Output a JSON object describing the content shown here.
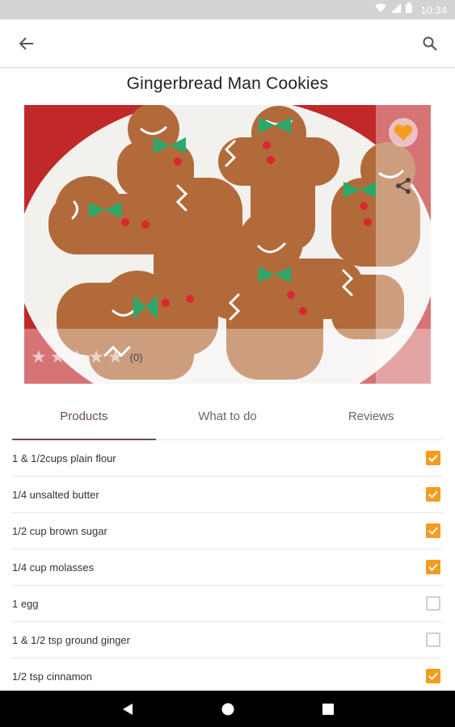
{
  "status_bar": {
    "time": "10:34",
    "icons": [
      "wifi-icon",
      "signal-icon",
      "battery-icon"
    ]
  },
  "app_bar": {
    "back_icon": "arrow-left-icon",
    "search_icon": "search-icon"
  },
  "recipe": {
    "title": "Gingerbread Man Cookies",
    "rating_count": "(0)",
    "rating_stars": 0,
    "favorite_icon": "heart-icon",
    "share_icon": "share-icon"
  },
  "tabs": [
    {
      "label": "Products",
      "active": true
    },
    {
      "label": "What to do",
      "active": false
    },
    {
      "label": "Reviews",
      "active": false
    }
  ],
  "products": [
    {
      "label": "1 & 1/2cups plain flour",
      "checked": true
    },
    {
      "label": "1/4 unsalted butter",
      "checked": true
    },
    {
      "label": "1/2 cup brown sugar",
      "checked": true
    },
    {
      "label": "1/4 cup molasses",
      "checked": true
    },
    {
      "label": "1 egg",
      "checked": false
    },
    {
      "label": "1 & 1/2 tsp ground ginger",
      "checked": false
    },
    {
      "label": "1/2 tsp cinnamon",
      "checked": true
    }
  ],
  "colors": {
    "accent_orange": "#f39c1e",
    "tab_active": "#6b4a6b",
    "status_bar": "#d3d3d3"
  }
}
